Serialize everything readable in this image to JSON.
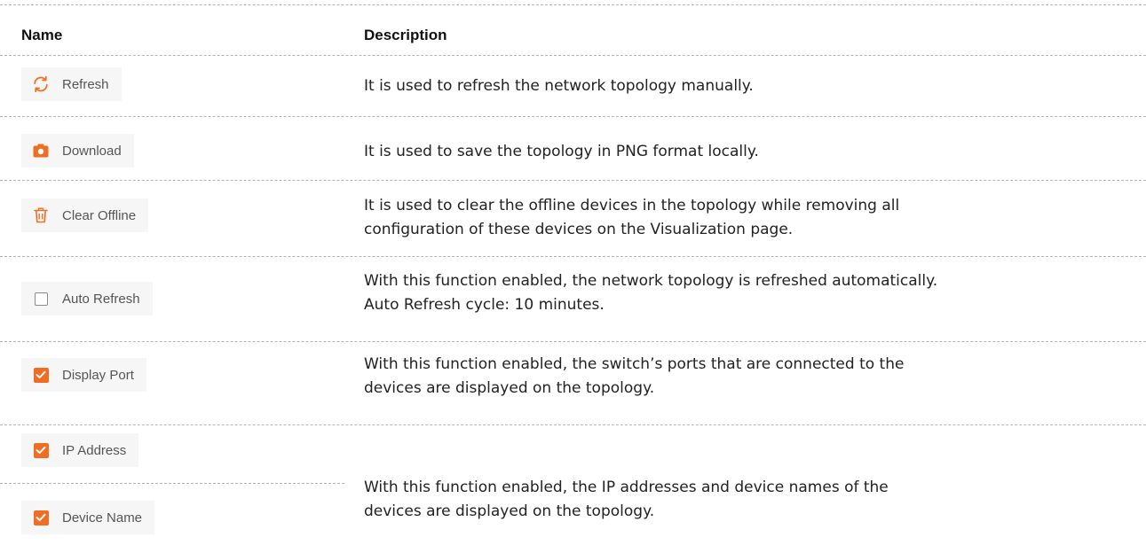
{
  "table": {
    "headers": {
      "name": "Name",
      "description": "Description"
    },
    "rows": [
      {
        "button_label": "Refresh",
        "icon": "refresh-icon",
        "description": [
          "It is used to refresh the network topology manually."
        ]
      },
      {
        "button_label": "Download",
        "icon": "camera-icon",
        "description": [
          "It is used to save the topology in PNG format locally."
        ]
      },
      {
        "button_label": "Clear Offline",
        "icon": "trash-icon",
        "description": [
          "It is used to clear the offline devices in the topology while removing all",
          "configuration of these devices on the Visualization page."
        ]
      },
      {
        "button_label": "Auto Refresh",
        "icon": "checkbox-unchecked-icon",
        "checked": false,
        "description": [
          "With this function enabled, the network topology is refreshed automatically.",
          "Auto Refresh cycle: 10 minutes."
        ]
      },
      {
        "button_label": "Display Port",
        "icon": "checkbox-checked-icon",
        "checked": true,
        "description": [
          "With this function enabled, the switch’s ports that are connected to the",
          "devices are displayed on the topology."
        ]
      },
      {
        "button_labels": [
          "IP Address",
          "Device Name"
        ],
        "icon": "checkbox-checked-icon",
        "checked": true,
        "description": [
          "With this function enabled, the IP addresses and device names of the",
          "devices are displayed on the topology."
        ]
      }
    ]
  },
  "colors": {
    "accent": "#f06e23",
    "button_bg": "#f6f6f6",
    "divider": "#b5b5b5"
  }
}
